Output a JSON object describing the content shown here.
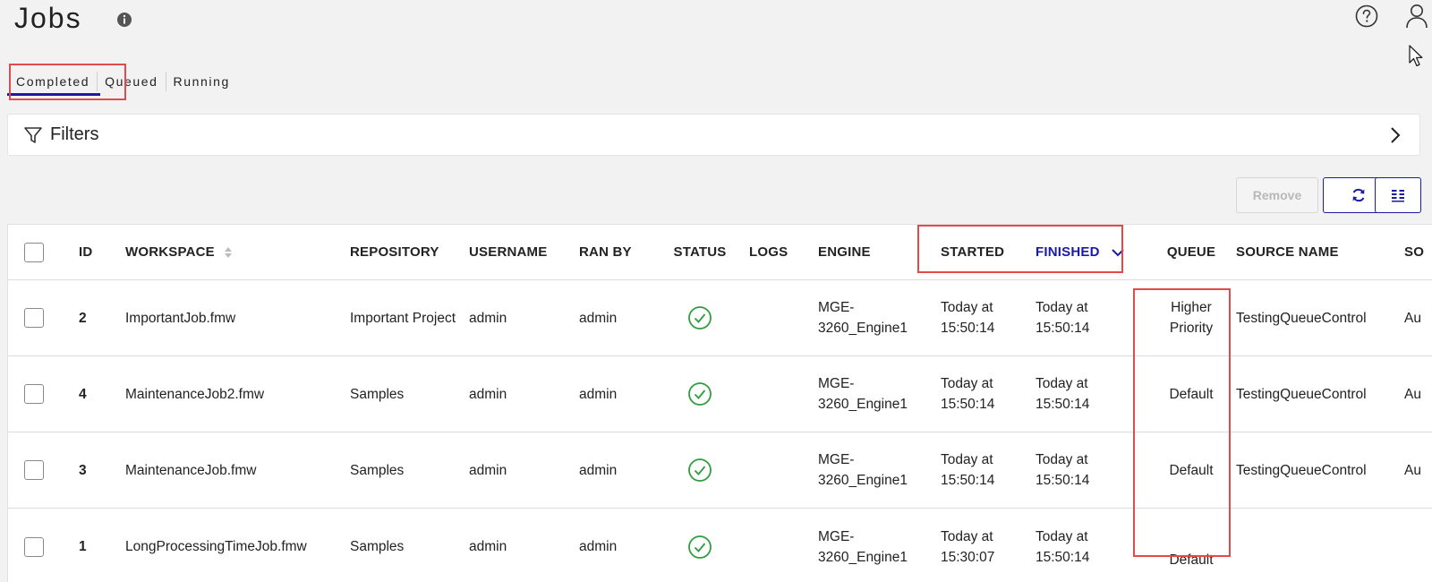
{
  "header": {
    "title": "Jobs",
    "icons": [
      "info-icon",
      "help-icon",
      "user-icon"
    ]
  },
  "tabs": [
    {
      "label": "Completed",
      "active": true
    },
    {
      "label": "Queued",
      "active": false
    },
    {
      "label": "Running",
      "active": false
    }
  ],
  "filters": {
    "label": "Filters",
    "icon": "filter-icon"
  },
  "actions": {
    "remove_label": "Remove"
  },
  "table": {
    "columns": [
      "ID",
      "WORKSPACE",
      "REPOSITORY",
      "USERNAME",
      "RAN BY",
      "STATUS",
      "LOGS",
      "ENGINE",
      "STARTED",
      "FINISHED",
      "QUEUE",
      "SOURCE NAME",
      "SO"
    ],
    "rows": [
      {
        "id": "2",
        "workspace": "ImportantJob.fmw",
        "repository": "Important Project",
        "username": "admin",
        "ran_by": "admin",
        "status": "success",
        "logs": "",
        "engine": "MGE-3260_Engine1",
        "started": "Today at 15:50:14",
        "finished": "Today at 15:50:14",
        "queue": "Higher Priority",
        "source_name": "TestingQueueControl",
        "so": "Au"
      },
      {
        "id": "4",
        "workspace": "MaintenanceJob2.fmw",
        "repository": "Samples",
        "username": "admin",
        "ran_by": "admin",
        "status": "success",
        "logs": "",
        "engine": "MGE-3260_Engine1",
        "started": "Today at 15:50:14",
        "finished": "Today at 15:50:14",
        "queue": "Default",
        "source_name": "TestingQueueControl",
        "so": "Au"
      },
      {
        "id": "3",
        "workspace": "MaintenanceJob.fmw",
        "repository": "Samples",
        "username": "admin",
        "ran_by": "admin",
        "status": "success",
        "logs": "",
        "engine": "MGE-3260_Engine1",
        "started": "Today at 15:50:14",
        "finished": "Today at 15:50:14",
        "queue": "Default",
        "source_name": "TestingQueueControl",
        "so": "Au"
      },
      {
        "id": "1",
        "workspace": "LongProcessingTimeJob.fmw",
        "repository": "Samples",
        "username": "admin",
        "ran_by": "admin",
        "status": "success",
        "logs": "",
        "engine": "MGE-3260_Engine1",
        "started": "Today at 15:30:07",
        "finished": "Today at 15:50:14",
        "queue": "Default",
        "source_name": "",
        "so": ""
      }
    ]
  },
  "colors": {
    "accent": "#1a1aa8",
    "success": "#2e9e3e",
    "annotation": "#e34b4b"
  }
}
